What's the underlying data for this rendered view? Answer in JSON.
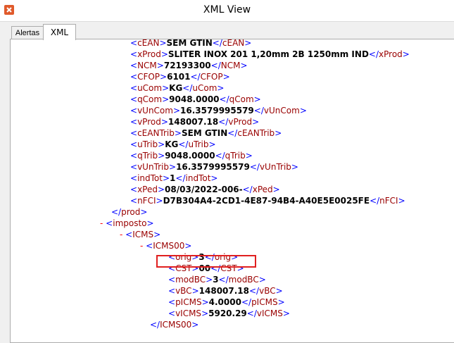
{
  "window": {
    "title": "XML View"
  },
  "tabs": [
    {
      "label": "Alertas",
      "active": false
    },
    {
      "label": "XML",
      "active": true
    }
  ],
  "xml_lines": [
    {
      "tag": "cEAN",
      "value": "SEM GTIN"
    },
    {
      "tag": "xProd",
      "value": "SLITER INOX 201 1,20mm 2B 1250mm IND"
    },
    {
      "tag": "NCM",
      "value": "72193300"
    },
    {
      "tag": "CFOP",
      "value": "6101"
    },
    {
      "tag": "uCom",
      "value": "KG"
    },
    {
      "tag": "qCom",
      "value": "9048.0000"
    },
    {
      "tag": "vUnCom",
      "value": "16.3579995579"
    },
    {
      "tag": "vProd",
      "value": "148007.18"
    },
    {
      "tag": "cEANTrib",
      "value": "SEM GTIN"
    },
    {
      "tag": "uTrib",
      "value": "KG"
    },
    {
      "tag": "qTrib",
      "value": "9048.0000"
    },
    {
      "tag": "vUnTrib",
      "value": "16.3579995579"
    },
    {
      "tag": "indTot",
      "value": "1"
    },
    {
      "tag": "xPed",
      "value": "08/03/2022-006-"
    },
    {
      "tag": "nFCI",
      "value": "D7B304A4-2CD1-4E87-94B4-A40E5E0025FE"
    }
  ],
  "close_prod": "prod",
  "imposto": {
    "marker": "-",
    "tag": "imposto"
  },
  "icms": {
    "marker": "-",
    "tag": "ICMS"
  },
  "icms00": {
    "marker": "-",
    "tag": "ICMS00"
  },
  "icms00_lines": [
    {
      "tag": "orig",
      "value": "3"
    },
    {
      "tag": "CST",
      "value": "00"
    },
    {
      "tag": "modBC",
      "value": "3"
    },
    {
      "tag": "vBC",
      "value": "148007.18"
    },
    {
      "tag": "pICMS",
      "value": "4.0000"
    },
    {
      "tag": "vICMS",
      "value": "5920.29"
    }
  ],
  "close_icms00": "ICMS00",
  "accent": {
    "bracket": "#0000ff",
    "tag": "#990000",
    "highlight": "#e02020"
  }
}
